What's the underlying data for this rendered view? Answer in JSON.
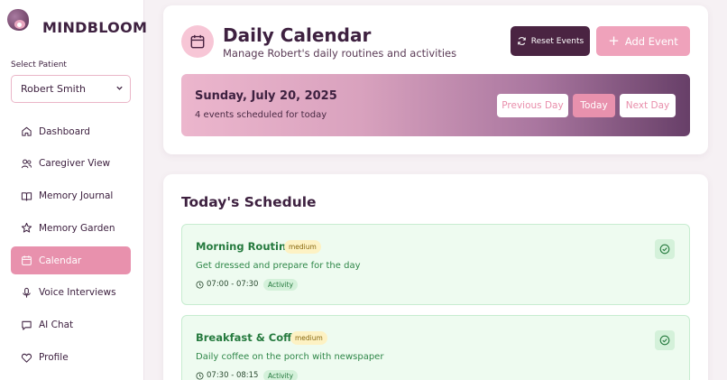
{
  "brand": {
    "name": "MINDBLOOM"
  },
  "patient": {
    "label": "Select Patient",
    "selected": "Robert Smith"
  },
  "nav": [
    {
      "label": "Dashboard",
      "icon": "home-icon"
    },
    {
      "label": "Caregiver View",
      "icon": "users-icon"
    },
    {
      "label": "Memory Journal",
      "icon": "book-icon"
    },
    {
      "label": "Memory Garden",
      "icon": "star-icon"
    },
    {
      "label": "Calendar",
      "icon": "calendar-icon",
      "active": true
    },
    {
      "label": "Voice Interviews",
      "icon": "microphone-icon"
    },
    {
      "label": "AI Chat",
      "icon": "chat-icon"
    },
    {
      "label": "Profile",
      "icon": "heart-icon"
    }
  ],
  "header": {
    "title": "Daily Calendar",
    "subtitle": "Manage Robert's daily routines and activities",
    "reset_label": "Reset Events",
    "add_label": "Add Event"
  },
  "banner": {
    "date": "Sunday, July 20, 2025",
    "count": "4 events scheduled for today",
    "prev_label": "Previous Day",
    "today_label": "Today",
    "next_label": "Next Day"
  },
  "schedule": {
    "title": "Today's Schedule",
    "events": [
      {
        "title": "Morning Routine",
        "priority": "medium",
        "description": "Get dressed and prepare for the day",
        "time": "07:00 - 07:30",
        "type": "Activity"
      },
      {
        "title": "Breakfast & Coffee",
        "priority": "medium",
        "description": "Daily coffee on the porch with newspaper",
        "time": "07:30 - 08:15",
        "type": "Activity"
      }
    ]
  },
  "colors": {
    "accent": "#e891ad",
    "dark": "#4a2442",
    "event_bg": "#eefbf0",
    "event_text": "#257a3e"
  }
}
